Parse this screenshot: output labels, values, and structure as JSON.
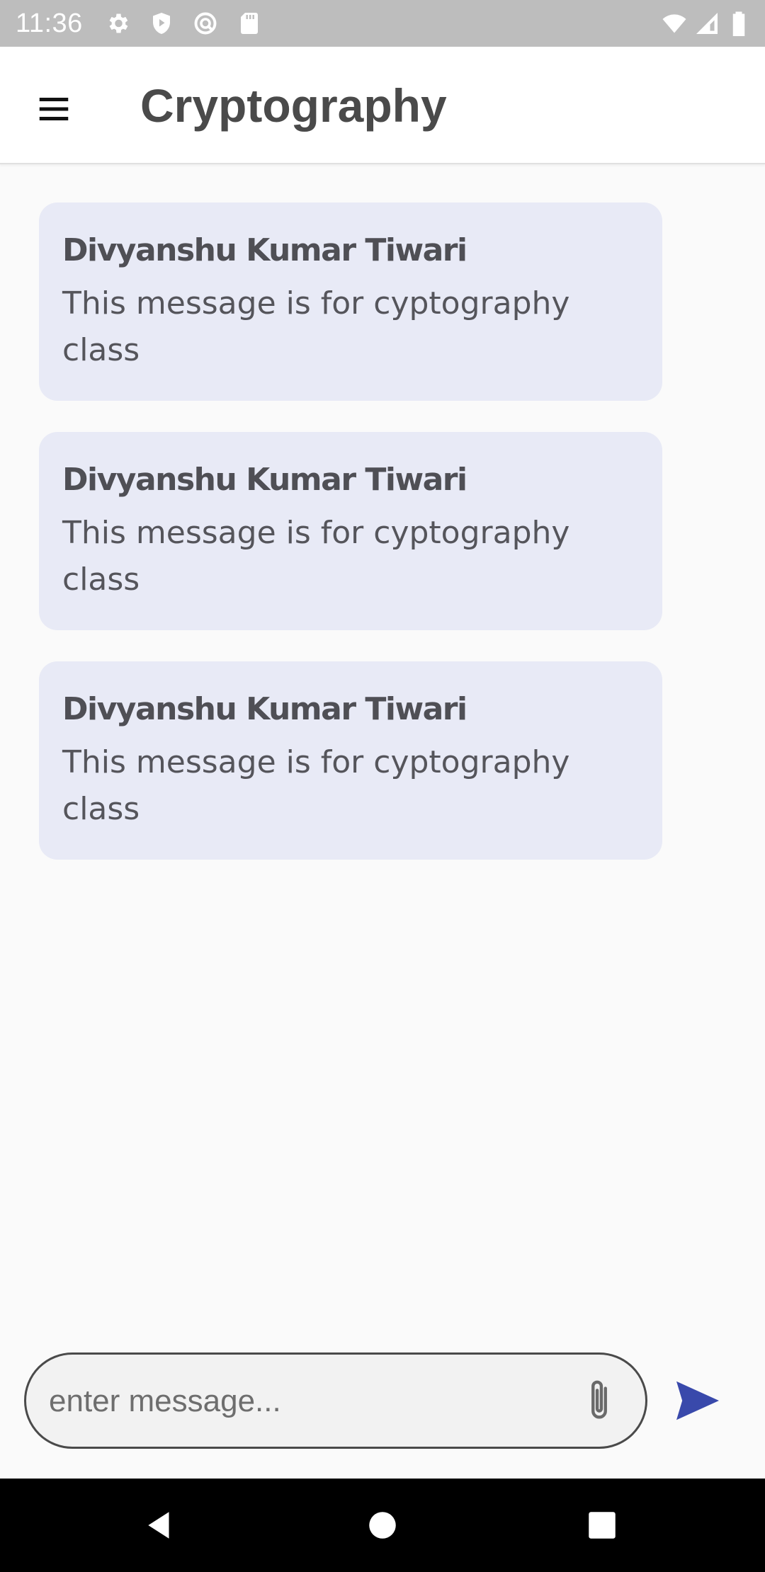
{
  "status_bar": {
    "time": "11:36",
    "left_icons": [
      "settings-icon",
      "shield-play-icon",
      "vpn-icon",
      "sd-card-icon"
    ],
    "right_icons": [
      "wifi-icon",
      "cellular-signal-icon",
      "battery-icon"
    ]
  },
  "app_bar": {
    "title": "Cryptography",
    "menu_icon": "hamburger-menu-icon"
  },
  "messages": [
    {
      "sender": "Divyanshu Kumar Tiwari",
      "text": "This message is for cyptography class"
    },
    {
      "sender": "Divyanshu Kumar Tiwari",
      "text": "This message is for cyptography class"
    },
    {
      "sender": "Divyanshu Kumar Tiwari",
      "text": "This message is for cyptography class"
    }
  ],
  "composer": {
    "placeholder": "enter message...",
    "value": "",
    "attach_icon": "paperclip-icon",
    "send_icon": "send-icon"
  },
  "nav_bar": {
    "buttons": [
      "back-icon",
      "home-icon",
      "recents-icon"
    ]
  },
  "colors": {
    "status_bar": "#bdbdbd",
    "app_bar": "#ffffff",
    "background": "#fafafa",
    "message_card": "#e8eaf6",
    "accent": "#3949ab",
    "nav_bar": "#000000"
  }
}
